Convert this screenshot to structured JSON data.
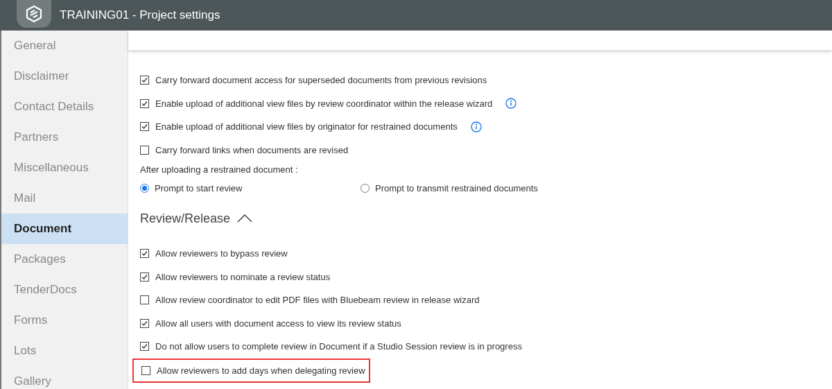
{
  "window": {
    "title": "TRAINING01 - Project settings"
  },
  "sidebar": {
    "items": [
      {
        "label": "General",
        "selected": false
      },
      {
        "label": "Disclaimer",
        "selected": false
      },
      {
        "label": "Contact Details",
        "selected": false
      },
      {
        "label": "Partners",
        "selected": false
      },
      {
        "label": "Miscellaneous",
        "selected": false
      },
      {
        "label": "Mail",
        "selected": false
      },
      {
        "label": "Document",
        "selected": true
      },
      {
        "label": "Packages",
        "selected": false
      },
      {
        "label": "TenderDocs",
        "selected": false
      },
      {
        "label": "Forms",
        "selected": false
      },
      {
        "label": "Lots",
        "selected": false
      },
      {
        "label": "Gallery",
        "selected": false
      }
    ]
  },
  "document_options": [
    {
      "label": "Carry forward document access for superseded documents from previous revisions",
      "checked": true,
      "info": false
    },
    {
      "label": "Enable upload of additional view files by review coordinator within the release wizard",
      "checked": true,
      "info": true
    },
    {
      "label": "Enable upload of additional view files by originator for restrained documents",
      "checked": true,
      "info": true
    },
    {
      "label": "Carry forward links when documents are revised",
      "checked": false,
      "info": false
    }
  ],
  "after_upload": {
    "label": "After uploading a restrained document :",
    "options": [
      {
        "label": "Prompt to start review",
        "selected": true
      },
      {
        "label": "Prompt to transmit restrained documents",
        "selected": false
      }
    ]
  },
  "review_release": {
    "title": "Review/Release",
    "expanded": true,
    "options": [
      {
        "label": "Allow reviewers to bypass review",
        "checked": true,
        "highlighted": false
      },
      {
        "label": "Allow reviewers to nominate a review status",
        "checked": true,
        "highlighted": false
      },
      {
        "label": "Allow review coordinator to edit PDF files with Bluebeam review in release wizard",
        "checked": false,
        "highlighted": false
      },
      {
        "label": "Allow all users with document access to view its review status",
        "checked": true,
        "highlighted": false
      },
      {
        "label": "Do not allow users to complete review in Document if a Studio Session review is in progress",
        "checked": true,
        "highlighted": false
      },
      {
        "label": "Allow reviewers to add days when delegating review",
        "checked": false,
        "highlighted": true
      }
    ]
  }
}
